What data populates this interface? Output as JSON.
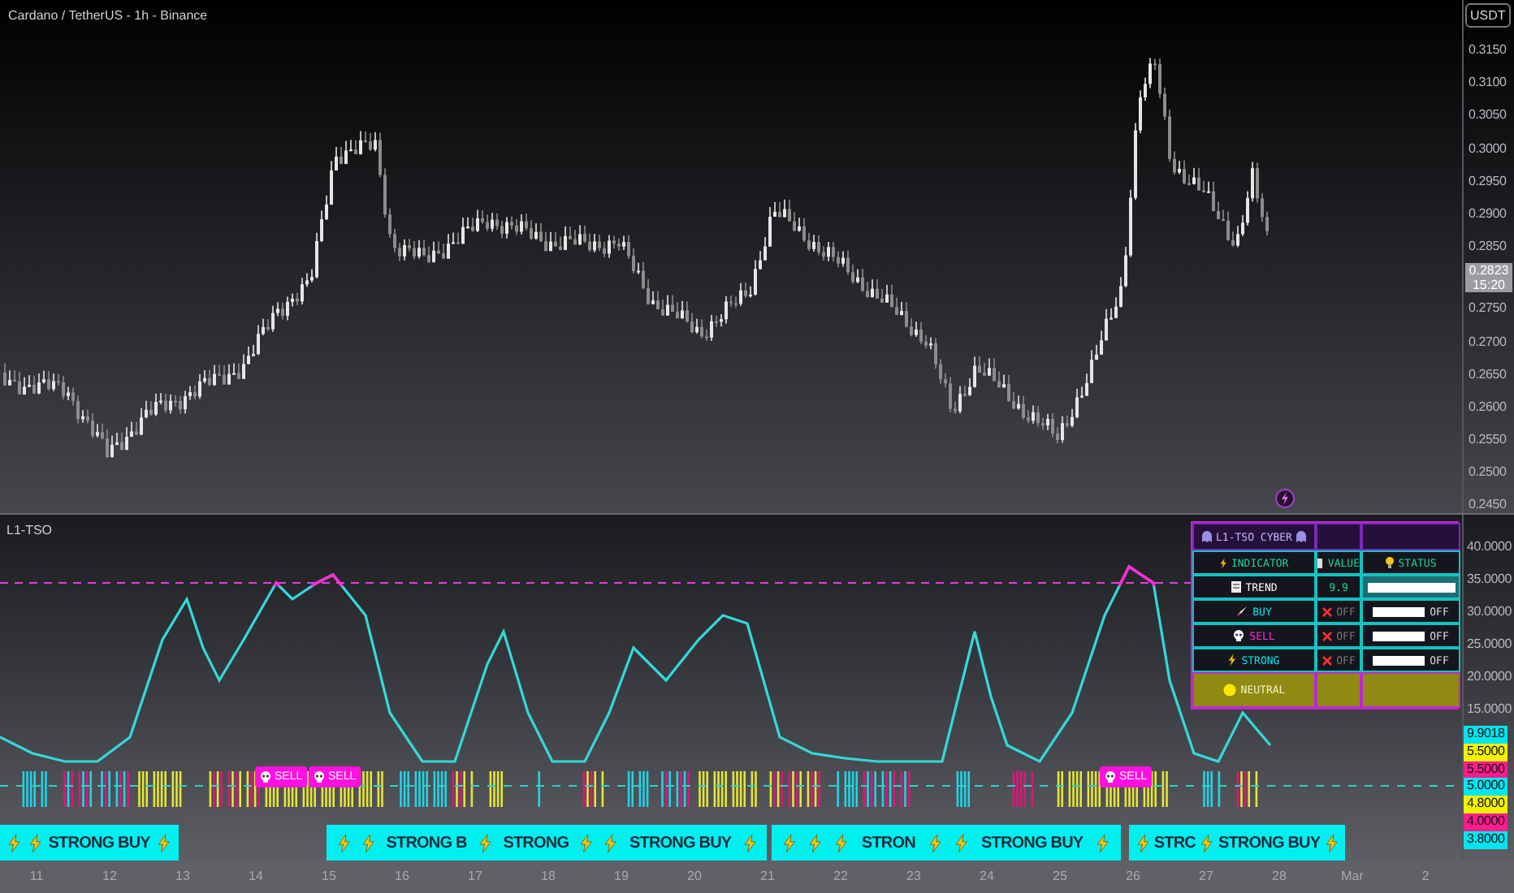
{
  "header": {
    "symbol_title": "Cardano / TetherUS - 1h - Binance",
    "currency_button": "USDT"
  },
  "price_axis": [
    {
      "kind": "label",
      "text": "0.3150"
    },
    {
      "kind": "label",
      "text": "0.3100"
    },
    {
      "kind": "label",
      "text": "0.3050"
    },
    {
      "kind": "label",
      "text": "0.3000"
    },
    {
      "kind": "label",
      "text": "0.2950"
    },
    {
      "kind": "label",
      "text": "0.2900"
    },
    {
      "kind": "label",
      "text": "0.2850"
    },
    {
      "kind": "current",
      "text": "0.2823",
      "countdown": "15:20"
    },
    {
      "kind": "label",
      "text": "0.2750"
    },
    {
      "kind": "label",
      "text": "0.2700"
    },
    {
      "kind": "label",
      "text": "0.2650"
    },
    {
      "kind": "label",
      "text": "0.2600"
    },
    {
      "kind": "label",
      "text": "0.2550"
    },
    {
      "kind": "label",
      "text": "0.2500"
    },
    {
      "kind": "label",
      "text": "0.2450"
    }
  ],
  "indicator": {
    "title": "L1-TSO",
    "axis_labels": [
      "40.0000",
      "35.0000",
      "30.0000",
      "25.0000",
      "20.0000",
      "15.0000"
    ],
    "value_tags": [
      {
        "text": "9.9018",
        "color": "#00e5f0"
      },
      {
        "text": "5.5000",
        "color": "#f2f200"
      },
      {
        "text": "5.5000",
        "color": "#ff1c8c"
      },
      {
        "text": "5.0000",
        "color": "#00e5f0"
      },
      {
        "text": "4.8000",
        "color": "#f2f200"
      },
      {
        "text": "4.0000",
        "color": "#ff1c8c"
      },
      {
        "text": "3.8000",
        "color": "#00e5f0"
      }
    ],
    "panel": {
      "title": "L1-TSO CYBER",
      "columns": [
        "INDICATOR",
        "VALUE",
        "STATUS"
      ],
      "rows": [
        {
          "kind": "trend",
          "name": "TREND",
          "value": "9.9",
          "level": 1,
          "color": "#ffffff"
        },
        {
          "kind": "buy",
          "name": "BUY",
          "value": "OFF",
          "status": "OFF",
          "color": "#00e5f0"
        },
        {
          "kind": "sell",
          "name": "SELL",
          "value": "OFF",
          "status": "OFF",
          "color": "#ff2bd6"
        },
        {
          "kind": "strong",
          "name": "STRONG",
          "value": "OFF",
          "status": "OFF",
          "color": "#00e5f0"
        }
      ],
      "state": "NEUTRAL"
    },
    "sell_tags": [
      {
        "text": "SELL"
      },
      {
        "text": "SELL"
      },
      {
        "text": "SELL"
      }
    ],
    "signal_boxes": [
      {
        "items": [
          {
            "kind": "bolt"
          },
          {
            "kind": "bolt"
          },
          {
            "kind": "text",
            "text": "STRONG BUY"
          },
          {
            "kind": "bolt"
          }
        ]
      },
      {
        "items": [
          {
            "kind": "bolt"
          },
          {
            "kind": "bolt"
          },
          {
            "kind": "text",
            "text": "STRONG B"
          },
          {
            "kind": "bolt"
          },
          {
            "kind": "text",
            "text": "STRONG"
          },
          {
            "kind": "bolt"
          },
          {
            "kind": "bolt"
          },
          {
            "kind": "text",
            "text": "STRONG BUY"
          },
          {
            "kind": "bolt"
          }
        ]
      },
      {
        "items": [
          {
            "kind": "bolt"
          },
          {
            "kind": "bolt"
          },
          {
            "kind": "bolt"
          },
          {
            "kind": "text",
            "text": "STRON"
          },
          {
            "kind": "bolt"
          },
          {
            "kind": "bolt"
          },
          {
            "kind": "text",
            "text": "STRONG BUY"
          },
          {
            "kind": "bolt"
          }
        ]
      },
      {
        "items": [
          {
            "kind": "bolt"
          },
          {
            "kind": "text",
            "text": "STRC"
          },
          {
            "kind": "bolt"
          },
          {
            "kind": "text",
            "text": "STRONG BUY"
          },
          {
            "kind": "bolt"
          }
        ]
      }
    ]
  },
  "time_axis": [
    "11",
    "12",
    "13",
    "14",
    "15",
    "16",
    "17",
    "18",
    "19",
    "20",
    "21",
    "22",
    "23",
    "24",
    "25",
    "26",
    "27",
    "28",
    "Mar",
    "2"
  ]
}
